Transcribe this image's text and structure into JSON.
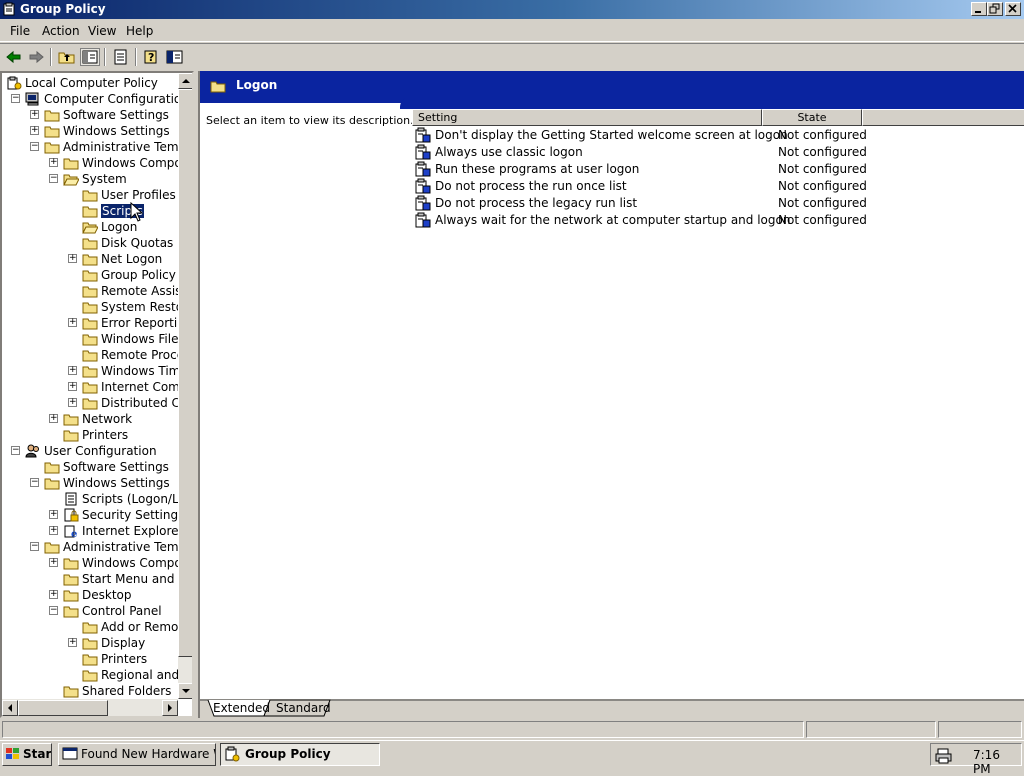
{
  "window": {
    "title": "Group Policy"
  },
  "menu": [
    "File",
    "Action",
    "View",
    "Help"
  ],
  "toolbar": {
    "icons": [
      "back-icon",
      "forward-icon",
      "up-folder-icon",
      "show-tree-icon",
      "export-list-icon",
      "help-icon",
      "properties-icon"
    ]
  },
  "tree": {
    "items": [
      {
        "label": "Local Computer Policy",
        "level": 0,
        "expander": "",
        "icon": "policy-icon"
      },
      {
        "label": "Computer Configuration",
        "level": 1,
        "expander": "-",
        "icon": "computer-icon"
      },
      {
        "label": "Software Settings",
        "level": 2,
        "expander": "+",
        "icon": "folder-icon"
      },
      {
        "label": "Windows Settings",
        "level": 2,
        "expander": "+",
        "icon": "folder-icon"
      },
      {
        "label": "Administrative Templates",
        "level": 2,
        "expander": "-",
        "icon": "folder-icon"
      },
      {
        "label": "Windows Components",
        "level": 3,
        "expander": "+",
        "icon": "folder-icon"
      },
      {
        "label": "System",
        "level": 3,
        "expander": "-",
        "icon": "folder-open-icon"
      },
      {
        "label": "User Profiles",
        "level": 4,
        "expander": "",
        "icon": "folder-icon"
      },
      {
        "label": "Scripts",
        "level": 4,
        "expander": "",
        "icon": "folder-icon",
        "selected": true
      },
      {
        "label": "Logon",
        "level": 4,
        "expander": "",
        "icon": "folder-open-icon"
      },
      {
        "label": "Disk Quotas",
        "level": 4,
        "expander": "",
        "icon": "folder-icon"
      },
      {
        "label": "Net Logon",
        "level": 4,
        "expander": "+",
        "icon": "folder-icon"
      },
      {
        "label": "Group Policy",
        "level": 4,
        "expander": "",
        "icon": "folder-icon"
      },
      {
        "label": "Remote Assistance",
        "level": 4,
        "expander": "",
        "icon": "folder-icon"
      },
      {
        "label": "System Restore",
        "level": 4,
        "expander": "",
        "icon": "folder-icon"
      },
      {
        "label": "Error Reporting",
        "level": 4,
        "expander": "+",
        "icon": "folder-icon"
      },
      {
        "label": "Windows File Protection",
        "level": 4,
        "expander": "",
        "icon": "folder-icon"
      },
      {
        "label": "Remote Procedure Call",
        "level": 4,
        "expander": "",
        "icon": "folder-icon"
      },
      {
        "label": "Windows Time Service",
        "level": 4,
        "expander": "+",
        "icon": "folder-icon"
      },
      {
        "label": "Internet Communication Management",
        "level": 4,
        "expander": "+",
        "icon": "folder-icon"
      },
      {
        "label": "Distributed COM",
        "level": 4,
        "expander": "+",
        "icon": "folder-icon"
      },
      {
        "label": "Network",
        "level": 3,
        "expander": "+",
        "icon": "folder-icon"
      },
      {
        "label": "Printers",
        "level": 3,
        "expander": "",
        "icon": "folder-icon"
      },
      {
        "label": "User Configuration",
        "level": 1,
        "expander": "-",
        "icon": "users-icon"
      },
      {
        "label": "Software Settings",
        "level": 2,
        "expander": "",
        "icon": "folder-icon"
      },
      {
        "label": "Windows Settings",
        "level": 2,
        "expander": "-",
        "icon": "folder-icon"
      },
      {
        "label": "Scripts (Logon/Logoff)",
        "level": 3,
        "expander": "",
        "icon": "script-icon"
      },
      {
        "label": "Security Settings",
        "level": 3,
        "expander": "+",
        "icon": "security-icon"
      },
      {
        "label": "Internet Explorer Maintenance",
        "level": 3,
        "expander": "+",
        "icon": "ie-icon"
      },
      {
        "label": "Administrative Templates",
        "level": 2,
        "expander": "-",
        "icon": "folder-icon"
      },
      {
        "label": "Windows Components",
        "level": 3,
        "expander": "+",
        "icon": "folder-icon"
      },
      {
        "label": "Start Menu and Taskbar",
        "level": 3,
        "expander": "",
        "icon": "folder-icon"
      },
      {
        "label": "Desktop",
        "level": 3,
        "expander": "+",
        "icon": "folder-icon"
      },
      {
        "label": "Control Panel",
        "level": 3,
        "expander": "-",
        "icon": "folder-icon"
      },
      {
        "label": "Add or Remove Programs",
        "level": 4,
        "expander": "",
        "icon": "folder-icon"
      },
      {
        "label": "Display",
        "level": 4,
        "expander": "+",
        "icon": "folder-icon"
      },
      {
        "label": "Printers",
        "level": 4,
        "expander": "",
        "icon": "folder-icon"
      },
      {
        "label": "Regional and Language Options",
        "level": 4,
        "expander": "",
        "icon": "folder-icon"
      },
      {
        "label": "Shared Folders",
        "level": 3,
        "expander": "",
        "icon": "folder-icon"
      }
    ]
  },
  "right": {
    "header_title": "Logon",
    "description": "Select an item to view its description.",
    "columns": [
      "Setting",
      "State"
    ],
    "rows": [
      {
        "setting": "Don't display the Getting Started welcome screen at logon",
        "state": "Not configured"
      },
      {
        "setting": "Always use classic logon",
        "state": "Not configured"
      },
      {
        "setting": "Run these programs at user logon",
        "state": "Not configured"
      },
      {
        "setting": "Do not process the run once list",
        "state": "Not configured"
      },
      {
        "setting": "Do not process the legacy run list",
        "state": "Not configured"
      },
      {
        "setting": "Always wait for the network at computer startup and logon",
        "state": "Not configured"
      }
    ],
    "tabs": [
      "Extended",
      "Standard"
    ]
  },
  "taskbar": {
    "start_label": "Start",
    "tasks": [
      {
        "label": "Found New Hardware Wi...",
        "icon": "hardware-wizard-icon",
        "active": false
      },
      {
        "label": "Group Policy",
        "icon": "group-policy-icon",
        "active": true
      }
    ],
    "clock": "7:16 PM",
    "tray_icons": [
      "printer-icon"
    ]
  },
  "colors": {
    "titlebar": "#0a246a",
    "selection": "#0a246a",
    "header": "#0a24a0",
    "face": "#d4d0c8"
  }
}
